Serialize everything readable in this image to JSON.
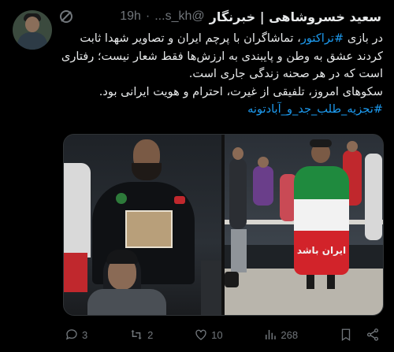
{
  "author": {
    "name": "سعید خسروشاهی | خبرنگار",
    "handle": "@s_kh...",
    "dot": "·",
    "time": "19h"
  },
  "tweet": {
    "line1_pre": "در بازی ",
    "hashtag1": "#تراکتور",
    "line1_post": "، تماشاگران با پرچم ایران و تصاویر شهدا ثابت کردند عشق به وطن و پایبندی به ارزش‌ها فقط شعار نیست؛ رفتاری است که در هر صحنه زندگی جاری است.",
    "line2": "سکوهای امروز، تلفیقی از غیرت، احترام و هویت ایرانی بود.",
    "hashtag2": "#تجزیه_طلب_جد_و_آبادتونه"
  },
  "media": {
    "banner_text": "ایران باشد"
  },
  "actions": {
    "replies": "3",
    "reposts": "2",
    "likes": "10",
    "views": "268"
  },
  "icons": [
    "grok-icon",
    "reply-icon",
    "repost-icon",
    "like-icon",
    "views-icon",
    "bookmark-icon",
    "share-icon"
  ],
  "colors": {
    "background": "#000000",
    "text": "#e7e9ea",
    "muted": "#71767b",
    "link": "#1d9bf0"
  }
}
